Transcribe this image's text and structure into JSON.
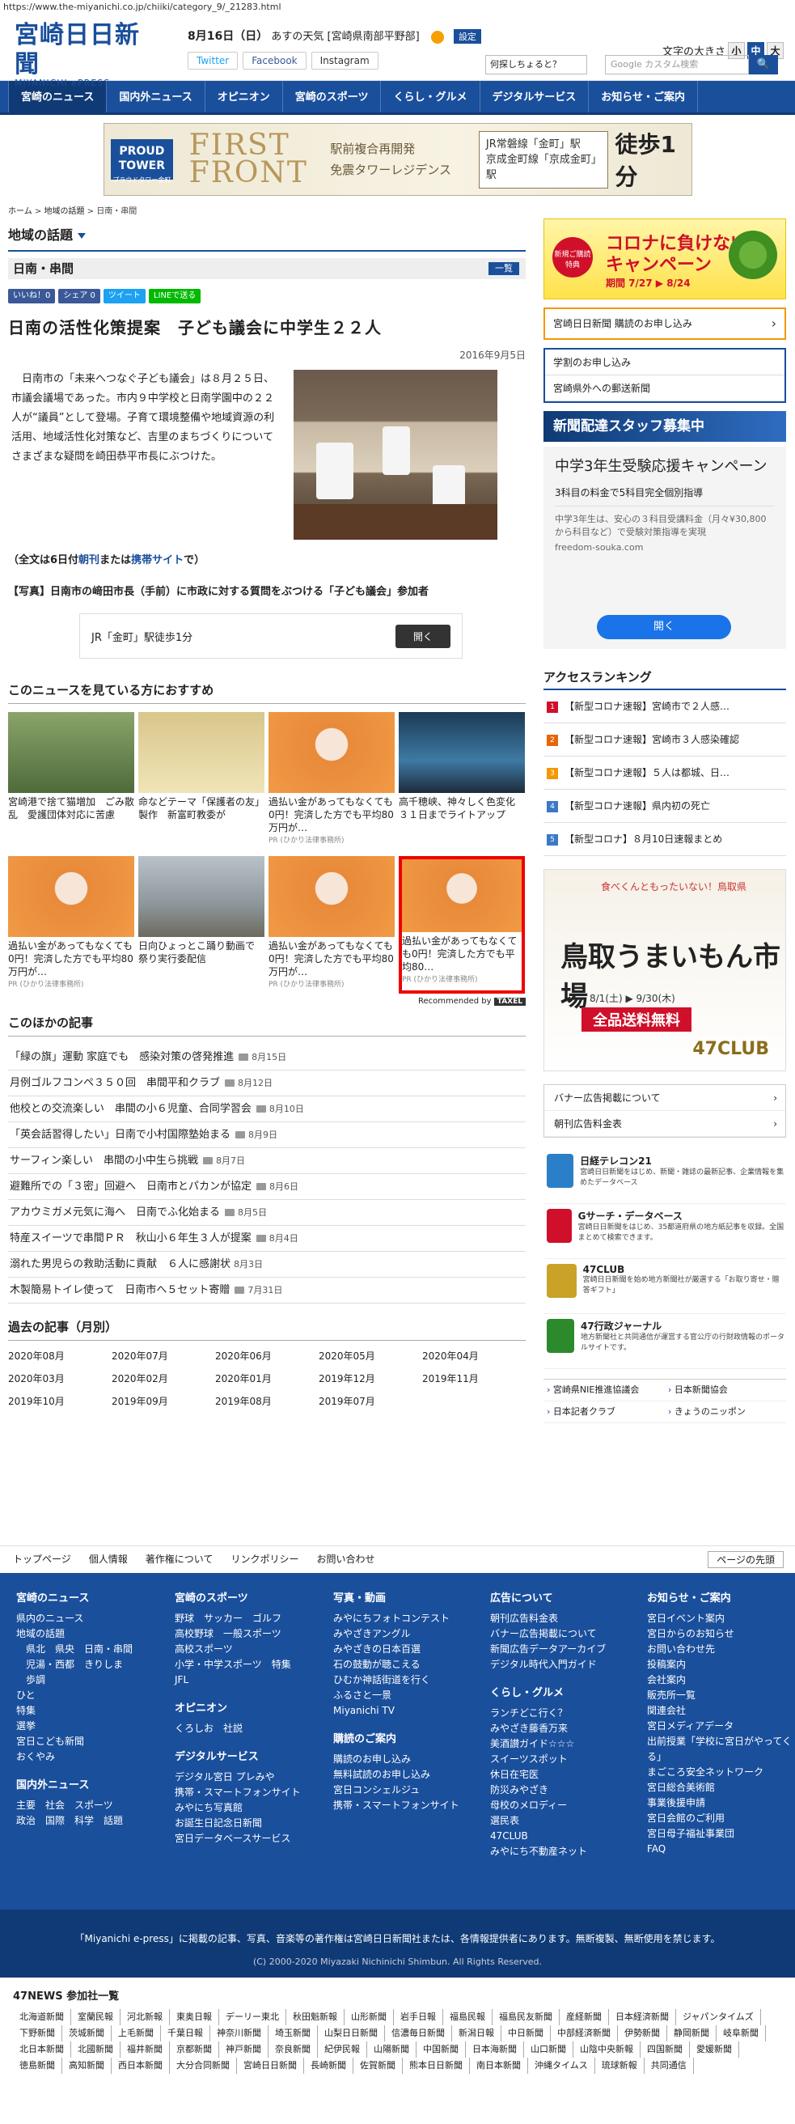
{
  "url": "https://www.the-miyanichi.co.jp/chiiki/category_9/_21283.html",
  "header": {
    "logo_ja": "宮崎日日新聞",
    "logo_en": "MIYANICHI ePRESS",
    "date": "8月16日（日）",
    "weather_label": "あすの天気 [宮崎県南部平野部]",
    "settei": "設定",
    "twitter": "Twitter",
    "facebook": "Facebook",
    "instagram": "Instagram",
    "fontsize_label": "文字の大きさ",
    "fontsize_options": [
      "小",
      "中",
      "大"
    ],
    "ask_label": "何探しちょると？",
    "search_placeholder": "Google カスタム検索"
  },
  "gnav": [
    "宮崎のニュース",
    "国内外ニュース",
    "オピニオン",
    "宮崎のスポーツ",
    "くらし・グルメ",
    "デジタルサービス",
    "お知らせ・ご案内"
  ],
  "banner": {
    "proud": "PROUD TOWER",
    "proud_sub": "プラウドタワー金町",
    "first": "FIRST FRONT",
    "mid1": "駅前複合再開発",
    "mid2": "免震タワーレジデンス",
    "right1": "JR常磐線「金町」駅",
    "right2": "京成金町線「京成金町」駅",
    "walk": "徒歩1分",
    "walk_note": "(現地敷地端まで)"
  },
  "breadcrumb": [
    "ホーム",
    "地域の話題",
    "日南・串間"
  ],
  "category_title": "地域の話題",
  "sub_title": "日南・串間",
  "list_btn": "一覧",
  "share": [
    "いいね！0",
    "シェア 0",
    "ツイート",
    "LINEで送る"
  ],
  "article": {
    "title": "日南の活性化策提案　子ども議会に中学生２２人",
    "date": "2016年9月5日",
    "body": "日南市の「未来へつなぐ子ども議会」は８月２５日、市議会議場であった。市内９中学校と日南学園中の２２人が“議員”として登場。子育て環境整備や地域資源の利活用、地域活性化対策など、吉里のまちづくりについてさまざまな疑問を崎田恭平市長にぶつけた。",
    "full_prefix": "（全文は6日付",
    "full_link1": "朝刊",
    "full_mid": "または",
    "full_link2": "携帯サイト",
    "full_suffix": "で）",
    "caption": "【写真】日南市の﨑田市長（手前）に市政に対する質問をぶつける「子ども議会」参加者"
  },
  "inline_ad": {
    "text": "JR「金町」駅徒歩1分",
    "button": "開く"
  },
  "recommend": {
    "title": "このニュースを見ている方におすすめ",
    "items": [
      {
        "text": "宮崎港で捨て猫増加　ごみ散乱　愛護団体対応に苦慮",
        "pr": ""
      },
      {
        "text": "命などテーマ「保護者の友」製作　新富町教委が",
        "pr": ""
      },
      {
        "text": "過払い金があってもなくても0円！完済した方でも平均80万円が…",
        "pr": "PR (ひかり法律事務所)"
      },
      {
        "text": "高千穂峡、神々しく色変化　３１日までライトアップ",
        "pr": ""
      },
      {
        "text": "過払い金があってもなくても0円！完済した方でも平均80万円が…",
        "pr": "PR (ひかり法律事務所)"
      },
      {
        "text": "日向ひょっとこ踊り動画で　祭り実行委配信",
        "pr": ""
      },
      {
        "text": "過払い金があってもなくても0円！完済した方でも平均80万円が…",
        "pr": "PR (ひかり法律事務所)"
      },
      {
        "text": "過払い金があってもなくても0円！完済した方でも平均80…",
        "pr": "PR (ひかり法律事務所)"
      }
    ],
    "by": "Recommended by",
    "by_brand": "TAXEL"
  },
  "others": {
    "title": "このほかの記事",
    "items": [
      {
        "t": "「緑の旗」運動 家庭でも　感染対策の啓発推進",
        "d": "8月15日",
        "cam": true
      },
      {
        "t": "月例ゴルフコンペ３５０回　串間平和クラブ",
        "d": "8月12日",
        "cam": true
      },
      {
        "t": "他校との交流楽しい　串間の小６児童、合同学習会",
        "d": "8月10日",
        "cam": true
      },
      {
        "t": "「英会話習得したい」日南で小村国際塾始まる",
        "d": "8月9日",
        "cam": true
      },
      {
        "t": "サーフィン楽しい　串間の小中生ら挑戦",
        "d": "8月7日",
        "cam": true
      },
      {
        "t": "避難所での「３密」回避へ　日南市とパカンが協定",
        "d": "8月6日",
        "cam": true
      },
      {
        "t": "アカウミガメ元気に海へ　日南でふ化始まる",
        "d": "8月5日",
        "cam": true
      },
      {
        "t": "特産スイーツで串間ＰＲ　秋山小６年生３人が提案",
        "d": "8月4日",
        "cam": true
      },
      {
        "t": "溺れた男児らの救助活動に貢献　６人に感謝状",
        "d": "8月3日",
        "cam": false
      },
      {
        "t": "木製簡易トイレ使って　日南市へ５セット寄贈",
        "d": "7月31日",
        "cam": true
      }
    ]
  },
  "past": {
    "title": "過去の記事（月別）",
    "items": [
      "2020年08月",
      "2020年07月",
      "2020年06月",
      "2020年05月",
      "2020年04月",
      "2020年03月",
      "2020年02月",
      "2020年01月",
      "2019年12月",
      "2019年11月",
      "2019年10月",
      "2019年09月",
      "2019年08月",
      "2019年07月"
    ]
  },
  "side": {
    "corona_t1": "コロナに負けない",
    "corona_t2": "キャンペーン",
    "corona_dates": "期間 7/27 ▶ 8/24",
    "corona_round": "新規ご購読 特典",
    "subscribe": "宮崎日日新聞 購読のお申し込み",
    "box": [
      "学割のお申し込み",
      "宮崎県外への郵送新聞"
    ],
    "staff": "新聞配達スタッフ募集中",
    "ad_h": "中学3年生受験応援キャンペーン",
    "ad_s": "3科目の料金で5科目完全個別指導",
    "ad_d": "中学3年生は、安心の３科目受講料金（月々¥30,800から科目など）で受験対策指導を実現",
    "ad_u": "freedom-souka.com",
    "ad_b": "開く",
    "rank_title": "アクセスランキング",
    "rank": [
      "【新型コロナ速報】宮崎市で２人感…",
      "【新型コロナ速報】宮崎市３人感染確認",
      "【新型コロナ速報】５人は都城、日…",
      "【新型コロナ速報】県内初の死亡",
      "【新型コロナ】８月10日速報まとめ"
    ],
    "rank_colors": [
      "#d0102a",
      "#e8640a",
      "#f39800",
      "#3c78c8",
      "#3c78c8"
    ],
    "fad_t1": "食べくんともったいない！鳥取県",
    "fad_t2": "鳥取うまいもん市場",
    "fad_t3": "8/1(土) ▶ 9/30(木)",
    "fad_t4": "全品送料無料",
    "fad_t5": "47CLUB",
    "links": [
      "バナー広告掲載について",
      "朝刊広告料金表"
    ],
    "svc": [
      {
        "t": "日経テレコン21",
        "d": "宮崎日日新聞をはじめ、新聞・雑誌の最新記事、企業情報を集めたデータベース",
        "c": "#2a7fc8"
      },
      {
        "t": "Gサーチ・データベース",
        "d": "宮崎日日新聞をはじめ、35都道府県の地方紙記事を収録。全国まとめて検索できます。",
        "c": "#d0102a"
      },
      {
        "t": "47CLUB",
        "d": "宮崎日日新聞を始め地方新聞社が厳選する「お取り寄せ・贈答ギフト」",
        "c": "#c9a227"
      },
      {
        "t": "47行政ジャーナル",
        "d": "地方新聞社と共同通信が運営する官公庁の行財政情報のポータルサイトです。",
        "c": "#2c8a2c"
      }
    ],
    "minilinks": [
      "宮崎県NIE推進協議会",
      "日本新聞協会",
      "日本記者クラブ",
      "きょうのニッポン"
    ]
  },
  "footer": {
    "links": [
      "トップページ",
      "個人情報",
      "著作権について",
      "リンクポリシー",
      "お問い合わせ"
    ],
    "top": "ページの先頭",
    "cols": [
      {
        "h": "宮崎のニュース",
        "p": [
          "県内のニュース",
          "地域の話題",
          "　県北　県央　日南・串間",
          "　児湯・西都　きりしま",
          "　歩調",
          "ひと",
          "特集",
          "選挙",
          "宮日こども新聞",
          "おくやみ"
        ],
        "h2": "国内外ニュース",
        "p2": [
          "主要　社会　スポーツ",
          "政治　国際　科学　話題"
        ]
      },
      {
        "h": "宮崎のスポーツ",
        "p": [
          "野球　サッカー　ゴルフ",
          "高校野球　一般スポーツ",
          "高校スポーツ",
          "小学・中学スポーツ　特集",
          "JFL"
        ],
        "h2": "オピニオン",
        "p2": [
          "くろしお　社説"
        ],
        "h3": "デジタルサービス",
        "p3": [
          "デジタル宮日 プレみや",
          "携帯・スマートフォンサイト",
          "みやにち写真館",
          "お誕生日記念日新聞",
          "宮日データベースサービス"
        ]
      },
      {
        "h": "写真・動画",
        "p": [
          "みやにちフォトコンテスト",
          "みやざきアングル",
          "みやざきの日本百選",
          "石の鼓動が聴こえる",
          "ひむか神話街道を行く",
          "ふるさと一景",
          "Miyanichi TV"
        ],
        "h2": "購読のご案内",
        "p2": [
          "購読のお申し込み",
          "無料試読のお申し込み",
          "宮日コンシェルジュ",
          "携帯・スマートフォンサイト"
        ]
      },
      {
        "h": "広告について",
        "p": [
          "朝刊広告料金表",
          "バナー広告掲載について",
          "新聞広告データアーカイブ",
          "デジタル時代入門ガイド"
        ],
        "h2": "くらし・グルメ",
        "p2": [
          "ランチどこ行く？",
          "みやざき藤香万来",
          "美酒讃ガイド☆☆☆",
          "スイーツスポット",
          "休日在宅医",
          "防災みやざき",
          "母校のメロディー",
          "選民表",
          "47CLUB",
          "みやにち不動産ネット"
        ]
      },
      {
        "h": "お知らせ・ご案内",
        "p": [
          "宮日イベント案内",
          "宮日からのお知らせ",
          "お問い合わせ先",
          "投稿案内",
          "会社案内",
          "販売所一覧",
          "関連会社",
          "宮日メディアデータ",
          "出前授業「学校に宮日がやってくる」",
          "まごころ安全ネットワーク",
          "宮日総合美術館",
          "事業後援申請",
          "宮日会館のご利用",
          "宮日母子福祉事業団",
          "FAQ"
        ]
      }
    ],
    "copy1": "「Miyanichi e-press」に掲載の記事、写真、音楽等の著作権は宮崎日日新聞社または、各情報提供者にあります。無断複製、無断使用を禁じます。",
    "copy2": "(C) 2000-2020 Miyazaki Nichinichi Shimbun. All Rights Reserved.",
    "n47_title": "47NEWS 参加社一覧",
    "n47": [
      "北海道新聞",
      "室蘭民報",
      "河北新報",
      "東奥日報",
      "デーリー東北",
      "秋田魁新報",
      "山形新聞",
      "岩手日報",
      "福島民報",
      "福島民友新聞",
      "産経新聞",
      "日本経済新聞",
      "ジャパンタイムズ",
      "下野新聞",
      "茨城新聞",
      "上毛新聞",
      "千葉日報",
      "神奈川新聞",
      "埼玉新聞",
      "山梨日日新聞",
      "信濃毎日新聞",
      "新潟日報",
      "中日新聞",
      "中部経済新聞",
      "伊勢新聞",
      "静岡新聞",
      "岐阜新聞",
      "北日本新聞",
      "北國新聞",
      "福井新聞",
      "京都新聞",
      "神戸新聞",
      "奈良新聞",
      "紀伊民報",
      "山陽新聞",
      "中国新聞",
      "日本海新聞",
      "山口新聞",
      "山陰中央新報",
      "四国新聞",
      "愛媛新聞",
      "徳島新聞",
      "高知新聞",
      "西日本新聞",
      "大分合同新聞",
      "宮崎日日新聞",
      "長崎新聞",
      "佐賀新聞",
      "熊本日日新聞",
      "南日本新聞",
      "沖縄タイムス",
      "琉球新報",
      "共同通信"
    ]
  }
}
